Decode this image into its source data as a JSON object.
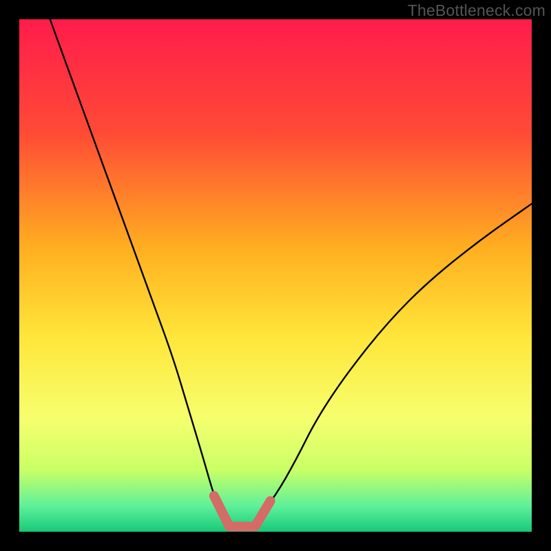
{
  "watermark": {
    "text": "TheBottleneck.com"
  },
  "colors": {
    "bg_black": "#000000",
    "curve": "#000000",
    "valley_marker": "#d46b66",
    "gradient_top": "#ff1c4b",
    "gradient_mid1": "#ff6a2a",
    "gradient_mid2": "#ffd21e",
    "gradient_mid3": "#fff96a",
    "gradient_low": "#d8ff5e",
    "gradient_bottom": "#21e38a",
    "gradient_bottom2": "#18c97a"
  },
  "chart_data": {
    "type": "line",
    "title": "",
    "xlabel": "",
    "ylabel": "",
    "xlim": [
      0,
      100
    ],
    "ylim": [
      0,
      100
    ],
    "series": [
      {
        "name": "bottleneck-curve",
        "x": [
          6,
          10,
          14,
          18,
          22,
          26,
          30,
          33,
          36,
          38,
          40,
          42,
          44,
          46,
          50,
          54,
          58,
          64,
          72,
          80,
          90,
          100
        ],
        "values": [
          100,
          89,
          78,
          67,
          56,
          45,
          34,
          24,
          14,
          7,
          2,
          0.5,
          0.5,
          2,
          7,
          14,
          22,
          31,
          41,
          49,
          57,
          64
        ]
      }
    ],
    "annotations": [
      {
        "name": "valley-start",
        "x": 38,
        "y": 7
      },
      {
        "name": "valley-floor-start",
        "x": 41,
        "y": 1
      },
      {
        "name": "valley-floor-end",
        "x": 46,
        "y": 1
      },
      {
        "name": "valley-end",
        "x": 49,
        "y": 6
      }
    ],
    "background_gradient_stops": [
      {
        "pct": 0,
        "color": "#ff1c4b"
      },
      {
        "pct": 22,
        "color": "#ff4a36"
      },
      {
        "pct": 45,
        "color": "#ffb020"
      },
      {
        "pct": 62,
        "color": "#ffe63a"
      },
      {
        "pct": 78,
        "color": "#f6ff6e"
      },
      {
        "pct": 88,
        "color": "#c9ff66"
      },
      {
        "pct": 95,
        "color": "#5ef09a"
      },
      {
        "pct": 100,
        "color": "#18c97a"
      }
    ]
  }
}
